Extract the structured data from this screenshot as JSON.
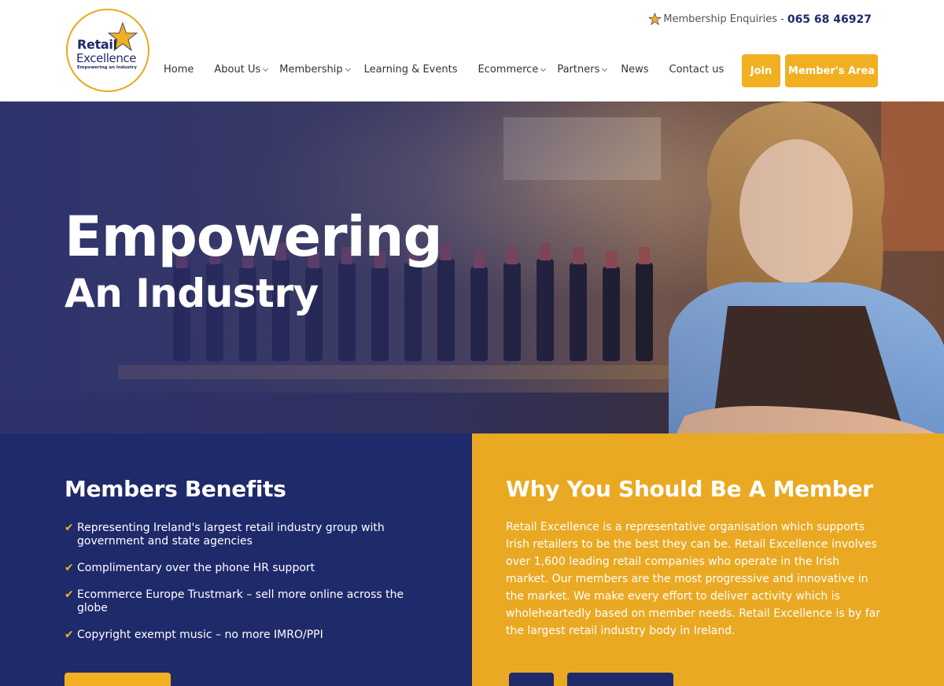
{
  "brand": {
    "name_line1": "Retail",
    "name_line2": "Excellence",
    "tagline": "Empowering an Industry",
    "color_primary": "#1f2a6b",
    "color_accent": "#f0b022"
  },
  "header": {
    "enquiries_label": "Membership Enquiries -",
    "enquiries_phone": "065 68 46927",
    "nav": [
      {
        "label": "Home",
        "has_dropdown": false
      },
      {
        "label": "About Us",
        "has_dropdown": true
      },
      {
        "label": "Membership",
        "has_dropdown": true
      },
      {
        "label": "Learning & Events",
        "has_dropdown": false
      },
      {
        "label": "Ecommerce",
        "has_dropdown": true
      },
      {
        "label": "Partners",
        "has_dropdown": true
      },
      {
        "label": "News",
        "has_dropdown": false
      },
      {
        "label": "Contact us",
        "has_dropdown": false
      }
    ],
    "join_label": "Join",
    "member_area_label": "Member's Area"
  },
  "hero": {
    "title": "Empowering",
    "subtitle": "An Industry"
  },
  "benefits": {
    "title": "Members Benefits",
    "items": [
      "Representing Ireland's largest retail industry group with government and state agencies",
      "Complimentary over the phone HR support",
      "Ecommerce Europe Trustmark – sell more online across the globe",
      "Copyright exempt music – no more IMRO/PPI"
    ]
  },
  "why": {
    "title": "Why You Should Be A Member",
    "body": "Retail Excellence is a representative organisation which supports Irish retailers to be the best they can be. Retail Excellence involves over 1,600 leading retail companies who operate in the Irish market. Our members are the most progressive and innovative in the market. We make every effort to deliver activity which is wholeheartedly based on member needs. Retail Excellence is by far the largest retail industry body in Ireland."
  }
}
